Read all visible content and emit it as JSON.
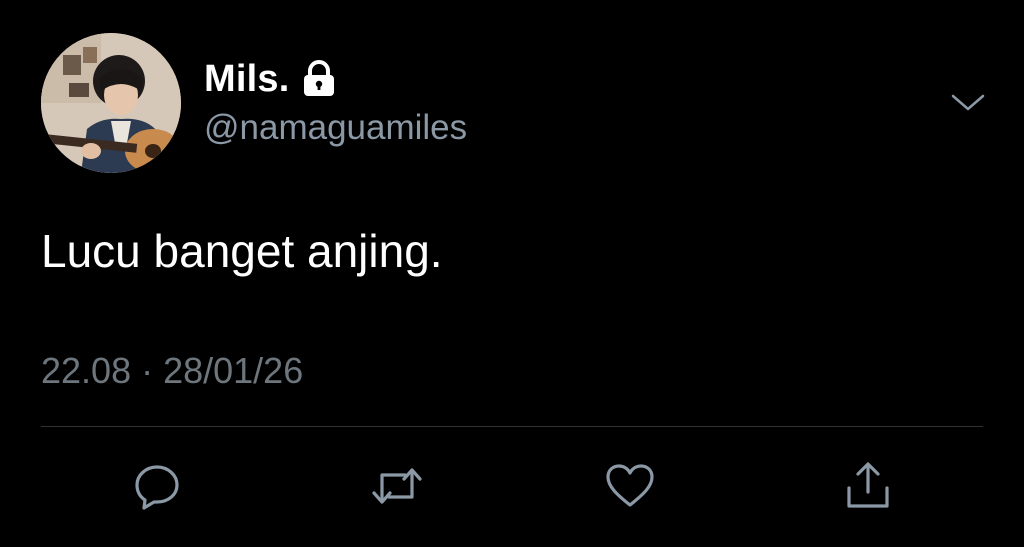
{
  "tweet": {
    "display_name": "Mils.",
    "handle": "@namaguamiles",
    "text": "Lucu banget anjing.",
    "timestamp": "22.08 · 28/01/26",
    "protected": true
  },
  "icons": {
    "lock": "lock-icon",
    "more": "chevron-down-icon",
    "reply": "reply-icon",
    "retweet": "retweet-icon",
    "like": "heart-icon",
    "share": "share-icon"
  },
  "colors": {
    "background": "#000000",
    "primary_text": "#ffffff",
    "secondary_text": "#8b98a5",
    "icon": "#8b98a5",
    "divider": "#2f3336"
  }
}
